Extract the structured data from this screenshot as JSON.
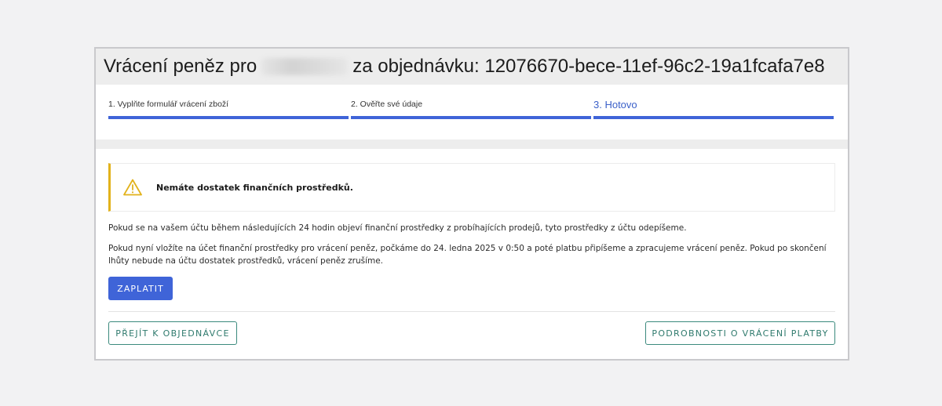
{
  "header": {
    "title_prefix": "Vrácení peněz pro",
    "title_suffix": "za objednávku: 12076670-bece-11ef-96c2-19a1fcafa7e8"
  },
  "steps": [
    {
      "label": "1. Vyplňte formulář vrácení zboží",
      "state": "done"
    },
    {
      "label": "2. Ověřte své údaje",
      "state": "done"
    },
    {
      "label": "3. Hotovo",
      "state": "active"
    }
  ],
  "alert": {
    "icon": "warning-icon",
    "message": "Nemáte dostatek finančních prostředků.",
    "accent_color": "#e2b21b"
  },
  "body": {
    "paragraph1": "Pokud se na vašem účtu během následujících 24 hodin objeví finanční prostředky z probíhajících prodejů, tyto prostředky z účtu odepíšeme.",
    "paragraph2": "Pokud nyní vložíte na účet finanční prostředky pro vrácení peněz, počkáme do 24. ledna 2025 v 0:50 a poté platbu připíšeme a zpracujeme vrácení peněz. Pokud po skončení lhůty nebude na účtu dostatek prostředků, vrácení peněz zrušíme."
  },
  "actions": {
    "pay_label": "ZAPLATIT",
    "go_to_order_label": "PŘEJÍT K OBJEDNÁVCE",
    "refund_details_label": "PODROBNOSTI O VRÁCENÍ PLATBY"
  },
  "colors": {
    "primary": "#3f64d8",
    "secondary_outline": "#3b8a7d",
    "warning": "#e2b21b"
  }
}
